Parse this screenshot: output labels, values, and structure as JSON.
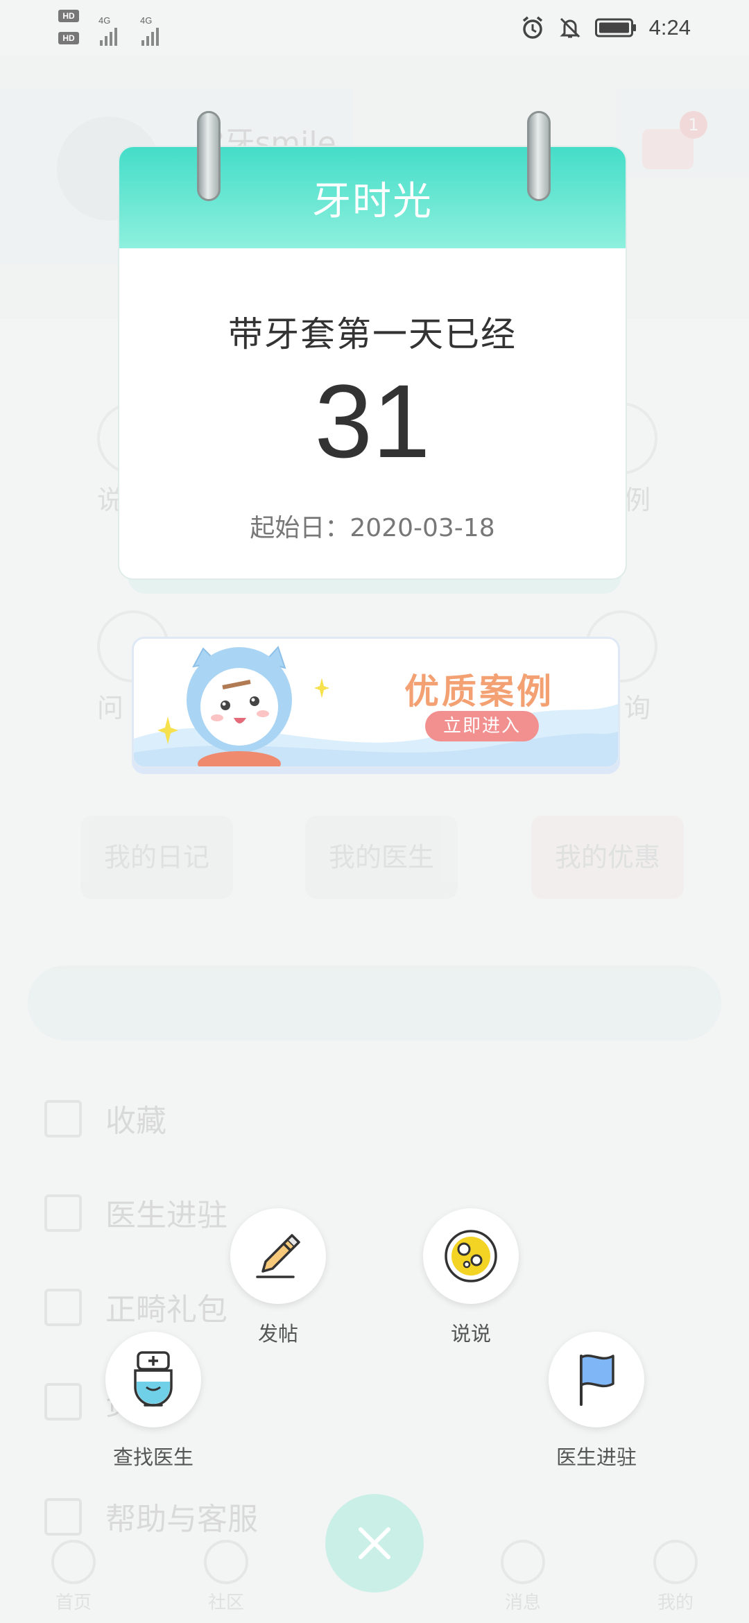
{
  "status_bar": {
    "hd1": "HD",
    "hd2": "HD",
    "net1": "4G",
    "net2": "4G",
    "time": "4:24"
  },
  "background": {
    "username": "?牙smile",
    "msg_badge": "1",
    "grid_row1": [
      "说",
      "",
      "",
      "例"
    ],
    "grid_row2": [
      "问",
      "",
      "",
      "询"
    ],
    "quick_buttons": [
      "我的日记",
      "我的医生",
      "我的优惠"
    ],
    "list_items": [
      "收藏",
      "医生进驻",
      "正畸礼包",
      "资料",
      "帮助与客服"
    ],
    "tabs": [
      "首页",
      "社区",
      "",
      "消息",
      "我的"
    ]
  },
  "calendar": {
    "title": "牙时光",
    "subtitle": "带牙套第一天已经",
    "days": "31",
    "start_label": "起始日：2020-03-18"
  },
  "banner": {
    "title": "优质案例",
    "button": "立即进入"
  },
  "actions": {
    "post": "发帖",
    "talk": "说说",
    "find_doctor": "查找医生",
    "doctor_join": "医生进驻"
  },
  "colors": {
    "accent": "#44ddc8",
    "close_fab": "#c9efe6",
    "banner_orange": "#f3a073",
    "banner_button": "#f29090"
  }
}
